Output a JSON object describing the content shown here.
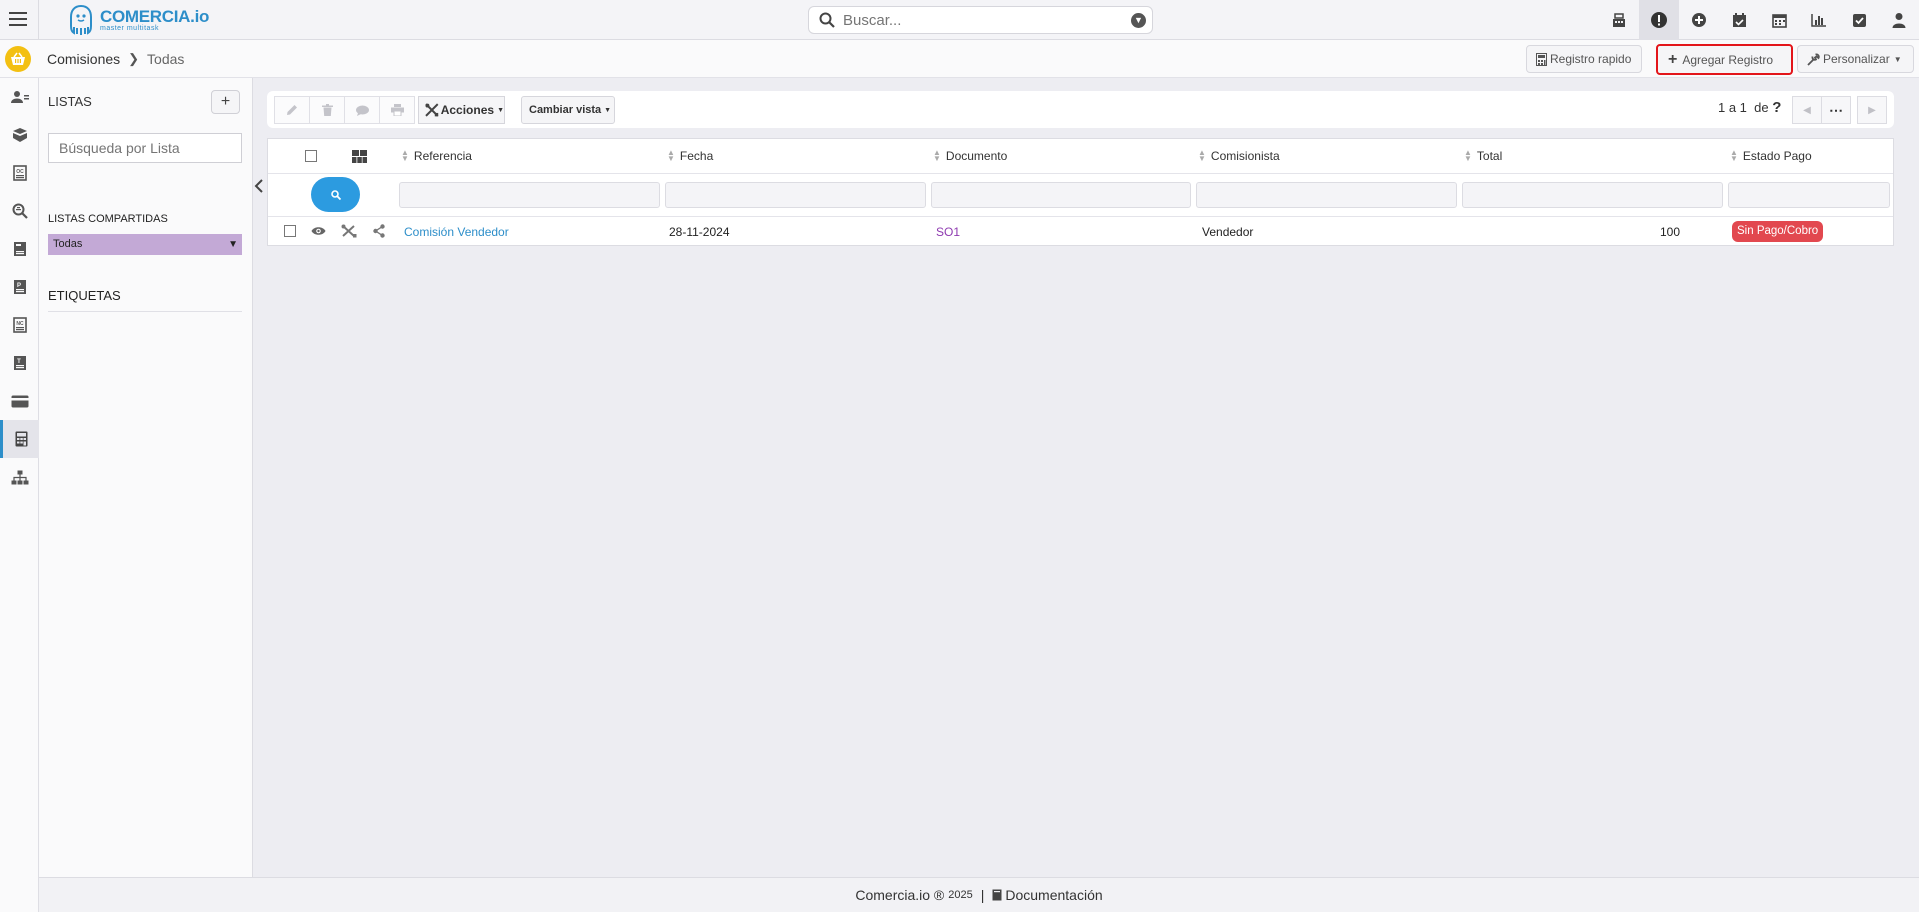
{
  "brand": {
    "name": "COMERCIA.io",
    "tagline": "master multitask"
  },
  "search": {
    "placeholder": "Buscar..."
  },
  "top_icons": [
    "cash-register-icon",
    "alert-icon",
    "plus-circle-icon",
    "calendar-check-icon",
    "calendar-icon",
    "chart-icon",
    "check-square-icon",
    "user-icon"
  ],
  "breadcrumb": {
    "section": "Comisiones",
    "current": "Todas"
  },
  "header_buttons": {
    "quick": "Registro rapido",
    "add": "Agregar Registro",
    "customize": "Personalizar"
  },
  "sidebar_icons": [
    "contacts-icon",
    "products-icon",
    "oc-icon",
    "search-doc-icon",
    "doc-icon",
    "p-doc-icon",
    "nc-doc-icon",
    "t-doc-icon",
    "card-icon",
    "calculator-icon",
    "sitemap-icon"
  ],
  "lists": {
    "title": "LISTAS",
    "search_placeholder": "Búsqueda por Lista",
    "shared_title": "LISTAS COMPARTIDAS",
    "shared_selected": "Todas",
    "tags_title": "ETIQUETAS"
  },
  "toolbar": {
    "actions": "Acciones",
    "change_view": "Cambiar vista",
    "pager": "1 a 1  de",
    "pager_help": "?"
  },
  "table": {
    "columns": [
      "Referencia",
      "Fecha",
      "Documento",
      "Comisionista",
      "Total",
      "Estado Pago"
    ],
    "rows": [
      {
        "referencia": "Comisión Vendedor",
        "fecha": "28-11-2024",
        "documento": "SO1",
        "comisionista": "Vendedor",
        "total": "100",
        "estado": "Sin Pago/Cobro"
      }
    ]
  },
  "colors": {
    "accent": "#2d8ec9",
    "status_unpaid": "#e2484f",
    "home_badge": "#f3c012",
    "shared_list": "#c3a9d6"
  },
  "footer": {
    "brand": "Comercia.io ®",
    "year": "2025",
    "docs": "Documentación"
  }
}
